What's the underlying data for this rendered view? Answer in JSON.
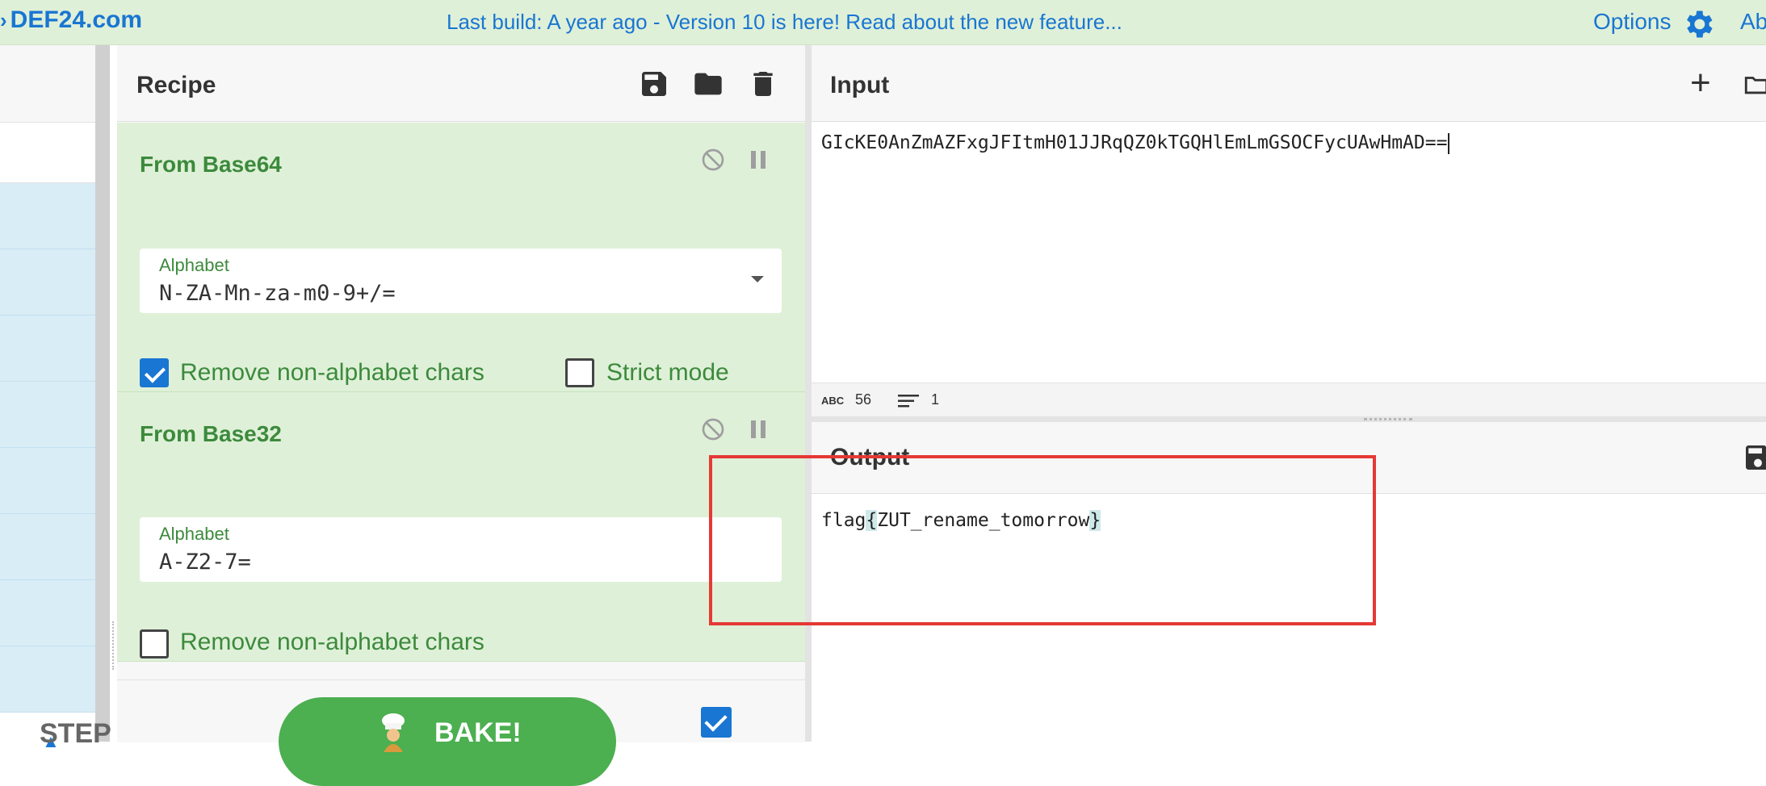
{
  "banner": {
    "brand": "DEF24.com",
    "notice": "Last build: A year ago - Version 10 is here! Read about the new feature...",
    "options_label": "Options",
    "about_label": "Ab"
  },
  "recipe": {
    "title": "Recipe",
    "operations": [
      {
        "name": "From Base64",
        "alphabet_label": "Alphabet",
        "alphabet_value": "N-ZA-Mn-za-m0-9+/=",
        "checkboxes": [
          {
            "label": "Remove non-alphabet chars",
            "checked": true
          },
          {
            "label": "Strict mode",
            "checked": false
          }
        ]
      },
      {
        "name": "From Base32",
        "alphabet_label": "Alphabet",
        "alphabet_value": "A-Z2-7=",
        "checkboxes": [
          {
            "label": "Remove non-alphabet chars",
            "checked": false
          }
        ]
      }
    ],
    "step_label": "STEP",
    "bake_label": "BAKE!",
    "auto_bake_checked": true
  },
  "input": {
    "title": "Input",
    "text": "GIcKE0AnZmAZFxgJFItmH01JJRqQZ0kTGQHlEmLmGSOCFycUAwHmAD==",
    "length": "56",
    "lines": "1",
    "abc_label": "ABC"
  },
  "output": {
    "title": "Output",
    "prefix": "flag",
    "open_brace": "{",
    "inner": "ZUT_rename_tomorrow",
    "close_brace": "}"
  },
  "colors": {
    "brand_blue": "#1976d2",
    "op_green_bg": "#dff0d8",
    "op_green_text": "#3c8a3c",
    "bake_green": "#4caf50",
    "annotation_red": "#e53935"
  }
}
